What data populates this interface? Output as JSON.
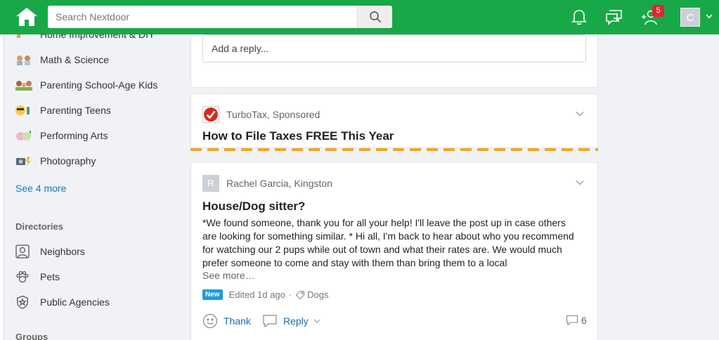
{
  "header": {
    "search_placeholder": "Search Nextdoor",
    "notifications_badge": "5",
    "avatar_initial": "C",
    "brand_color": "#19a848"
  },
  "sidebar": {
    "groups_partial": [
      {
        "label": "Home Improvement & DIY",
        "icon": "tools-emoji-icon"
      },
      {
        "label": "Math & Science",
        "icon": "scientists-emoji-icon"
      },
      {
        "label": "Parenting School-Age Kids",
        "icon": "family-emoji-icon"
      },
      {
        "label": "Parenting Teens",
        "icon": "teen-emoji-icon"
      },
      {
        "label": "Performing Arts",
        "icon": "performers-emoji-icon"
      },
      {
        "label": "Photography",
        "icon": "camera-flash-emoji-icon"
      }
    ],
    "see_more": "See 4 more",
    "directories_heading": "Directories",
    "directories": [
      {
        "label": "Neighbors",
        "icon": "person-icon"
      },
      {
        "label": "Pets",
        "icon": "paw-icon"
      },
      {
        "label": "Public Agencies",
        "icon": "badge-icon"
      }
    ],
    "groups_heading": "Groups"
  },
  "feed": {
    "reply_placeholder": "Add a reply...",
    "ad": {
      "source": "TurboTax, Sponsored",
      "title": "How to File Taxes FREE This Year"
    },
    "post": {
      "avatar_initial": "R",
      "author": "Rachel Garcia, Kingston",
      "title": "House/Dog sitter?",
      "body": "*We found someone, thank you for all your help! I'll leave the post up in case others are looking for something similar. * Hi all, I'm back to hear about who you recommend for watching our 2 pups while out of town and what their rates are. We would much prefer someone to come and stay with them than bring them to a local",
      "see_more": "See more…",
      "badge": "New",
      "edited": "Edited 1d ago",
      "separator": "·",
      "tag": "Dogs",
      "thank_label": "Thank",
      "reply_label": "Reply",
      "comment_count": "6"
    }
  }
}
